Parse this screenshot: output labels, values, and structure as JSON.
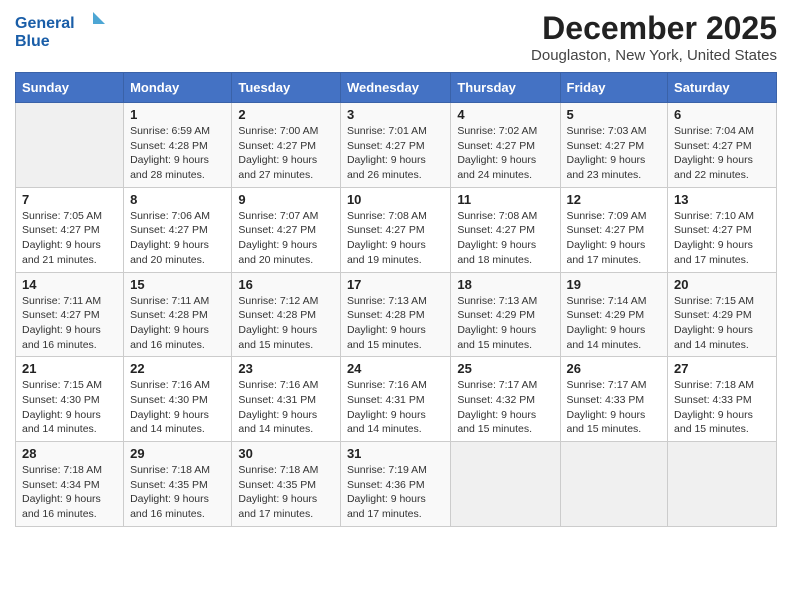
{
  "header": {
    "logo_line1": "General",
    "logo_line2": "Blue",
    "title": "December 2025",
    "subtitle": "Douglaston, New York, United States"
  },
  "calendar": {
    "days_of_week": [
      "Sunday",
      "Monday",
      "Tuesday",
      "Wednesday",
      "Thursday",
      "Friday",
      "Saturday"
    ],
    "weeks": [
      [
        {
          "day": "",
          "info": ""
        },
        {
          "day": "1",
          "info": "Sunrise: 6:59 AM\nSunset: 4:28 PM\nDaylight: 9 hours\nand 28 minutes."
        },
        {
          "day": "2",
          "info": "Sunrise: 7:00 AM\nSunset: 4:27 PM\nDaylight: 9 hours\nand 27 minutes."
        },
        {
          "day": "3",
          "info": "Sunrise: 7:01 AM\nSunset: 4:27 PM\nDaylight: 9 hours\nand 26 minutes."
        },
        {
          "day": "4",
          "info": "Sunrise: 7:02 AM\nSunset: 4:27 PM\nDaylight: 9 hours\nand 24 minutes."
        },
        {
          "day": "5",
          "info": "Sunrise: 7:03 AM\nSunset: 4:27 PM\nDaylight: 9 hours\nand 23 minutes."
        },
        {
          "day": "6",
          "info": "Sunrise: 7:04 AM\nSunset: 4:27 PM\nDaylight: 9 hours\nand 22 minutes."
        }
      ],
      [
        {
          "day": "7",
          "info": "Sunrise: 7:05 AM\nSunset: 4:27 PM\nDaylight: 9 hours\nand 21 minutes."
        },
        {
          "day": "8",
          "info": "Sunrise: 7:06 AM\nSunset: 4:27 PM\nDaylight: 9 hours\nand 20 minutes."
        },
        {
          "day": "9",
          "info": "Sunrise: 7:07 AM\nSunset: 4:27 PM\nDaylight: 9 hours\nand 20 minutes."
        },
        {
          "day": "10",
          "info": "Sunrise: 7:08 AM\nSunset: 4:27 PM\nDaylight: 9 hours\nand 19 minutes."
        },
        {
          "day": "11",
          "info": "Sunrise: 7:08 AM\nSunset: 4:27 PM\nDaylight: 9 hours\nand 18 minutes."
        },
        {
          "day": "12",
          "info": "Sunrise: 7:09 AM\nSunset: 4:27 PM\nDaylight: 9 hours\nand 17 minutes."
        },
        {
          "day": "13",
          "info": "Sunrise: 7:10 AM\nSunset: 4:27 PM\nDaylight: 9 hours\nand 17 minutes."
        }
      ],
      [
        {
          "day": "14",
          "info": "Sunrise: 7:11 AM\nSunset: 4:27 PM\nDaylight: 9 hours\nand 16 minutes."
        },
        {
          "day": "15",
          "info": "Sunrise: 7:11 AM\nSunset: 4:28 PM\nDaylight: 9 hours\nand 16 minutes."
        },
        {
          "day": "16",
          "info": "Sunrise: 7:12 AM\nSunset: 4:28 PM\nDaylight: 9 hours\nand 15 minutes."
        },
        {
          "day": "17",
          "info": "Sunrise: 7:13 AM\nSunset: 4:28 PM\nDaylight: 9 hours\nand 15 minutes."
        },
        {
          "day": "18",
          "info": "Sunrise: 7:13 AM\nSunset: 4:29 PM\nDaylight: 9 hours\nand 15 minutes."
        },
        {
          "day": "19",
          "info": "Sunrise: 7:14 AM\nSunset: 4:29 PM\nDaylight: 9 hours\nand 14 minutes."
        },
        {
          "day": "20",
          "info": "Sunrise: 7:15 AM\nSunset: 4:29 PM\nDaylight: 9 hours\nand 14 minutes."
        }
      ],
      [
        {
          "day": "21",
          "info": "Sunrise: 7:15 AM\nSunset: 4:30 PM\nDaylight: 9 hours\nand 14 minutes."
        },
        {
          "day": "22",
          "info": "Sunrise: 7:16 AM\nSunset: 4:30 PM\nDaylight: 9 hours\nand 14 minutes."
        },
        {
          "day": "23",
          "info": "Sunrise: 7:16 AM\nSunset: 4:31 PM\nDaylight: 9 hours\nand 14 minutes."
        },
        {
          "day": "24",
          "info": "Sunrise: 7:16 AM\nSunset: 4:31 PM\nDaylight: 9 hours\nand 14 minutes."
        },
        {
          "day": "25",
          "info": "Sunrise: 7:17 AM\nSunset: 4:32 PM\nDaylight: 9 hours\nand 15 minutes."
        },
        {
          "day": "26",
          "info": "Sunrise: 7:17 AM\nSunset: 4:33 PM\nDaylight: 9 hours\nand 15 minutes."
        },
        {
          "day": "27",
          "info": "Sunrise: 7:18 AM\nSunset: 4:33 PM\nDaylight: 9 hours\nand 15 minutes."
        }
      ],
      [
        {
          "day": "28",
          "info": "Sunrise: 7:18 AM\nSunset: 4:34 PM\nDaylight: 9 hours\nand 16 minutes."
        },
        {
          "day": "29",
          "info": "Sunrise: 7:18 AM\nSunset: 4:35 PM\nDaylight: 9 hours\nand 16 minutes."
        },
        {
          "day": "30",
          "info": "Sunrise: 7:18 AM\nSunset: 4:35 PM\nDaylight: 9 hours\nand 17 minutes."
        },
        {
          "day": "31",
          "info": "Sunrise: 7:19 AM\nSunset: 4:36 PM\nDaylight: 9 hours\nand 17 minutes."
        },
        {
          "day": "",
          "info": ""
        },
        {
          "day": "",
          "info": ""
        },
        {
          "day": "",
          "info": ""
        }
      ]
    ]
  }
}
